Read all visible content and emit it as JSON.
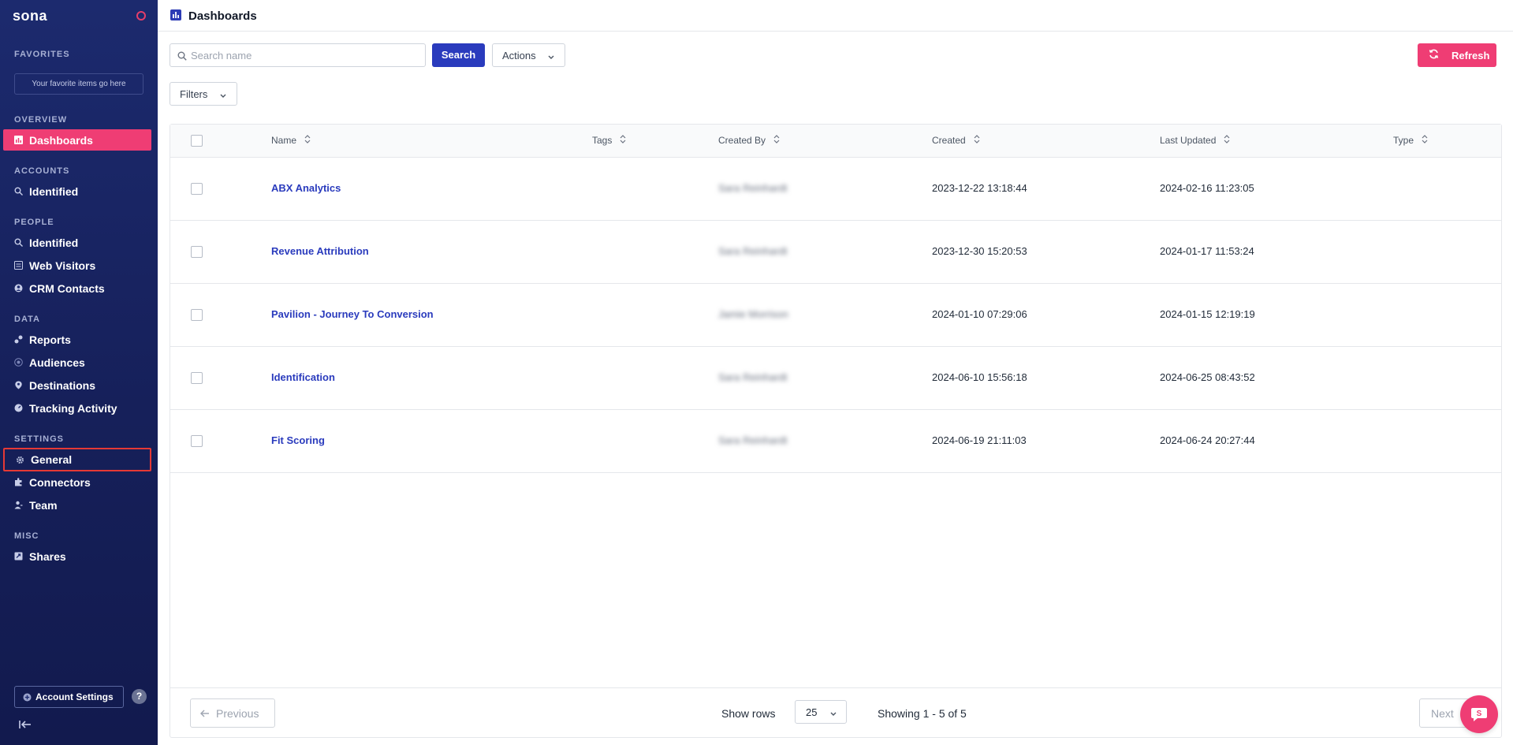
{
  "app": {
    "logo": "sona"
  },
  "sidebar": {
    "favorites_label": "FAVORITES",
    "favorites_placeholder": "Your favorite items go here",
    "overview_label": "OVERVIEW",
    "dashboards": "Dashboards",
    "accounts_label": "ACCOUNTS",
    "accounts_identified": "Identified",
    "people_label": "PEOPLE",
    "people_identified": "Identified",
    "web_visitors": "Web Visitors",
    "crm_contacts": "CRM Contacts",
    "data_label": "DATA",
    "reports": "Reports",
    "audiences": "Audiences",
    "destinations": "Destinations",
    "tracking_activity": "Tracking Activity",
    "settings_label": "SETTINGS",
    "general": "General",
    "connectors": "Connectors",
    "team": "Team",
    "misc_label": "MISC",
    "shares": "Shares",
    "account_settings": "Account Settings",
    "help": "?"
  },
  "header": {
    "title": "Dashboards"
  },
  "toolbar": {
    "search_placeholder": "Search name",
    "search_button": "Search",
    "actions_button": "Actions",
    "refresh_button": "Refresh",
    "filters_button": "Filters"
  },
  "table": {
    "columns": [
      "Name",
      "Tags",
      "Created By",
      "Created",
      "Last Updated",
      "Type"
    ],
    "rows": [
      {
        "name": "ABX Analytics",
        "tags": "",
        "created_by": "Sara Reinhardt",
        "created": "2023-12-22 13:18:44",
        "last_updated": "2024-02-16 11:23:05",
        "type": ""
      },
      {
        "name": "Revenue Attribution",
        "tags": "",
        "created_by": "Sara Reinhardt",
        "created": "2023-12-30 15:20:53",
        "last_updated": "2024-01-17 11:53:24",
        "type": ""
      },
      {
        "name": "Pavilion - Journey To Conversion",
        "tags": "",
        "created_by": "Jamie Morrison",
        "created": "2024-01-10 07:29:06",
        "last_updated": "2024-01-15 12:19:19",
        "type": ""
      },
      {
        "name": "Identification",
        "tags": "",
        "created_by": "Sara Reinhardt",
        "created": "2024-06-10 15:56:18",
        "last_updated": "2024-06-25 08:43:52",
        "type": ""
      },
      {
        "name": "Fit Scoring",
        "tags": "",
        "created_by": "Sara Reinhardt",
        "created": "2024-06-19 21:11:03",
        "last_updated": "2024-06-24 20:27:44",
        "type": ""
      }
    ]
  },
  "pager": {
    "previous": "Previous",
    "show_rows_label": "Show rows",
    "rows_value": "25",
    "showing": "Showing 1 - 5 of 5",
    "next": "Next"
  },
  "colors": {
    "brand": "#2a3bbd",
    "accent": "#ef3d74",
    "sidebar": "#1c2a6e"
  }
}
